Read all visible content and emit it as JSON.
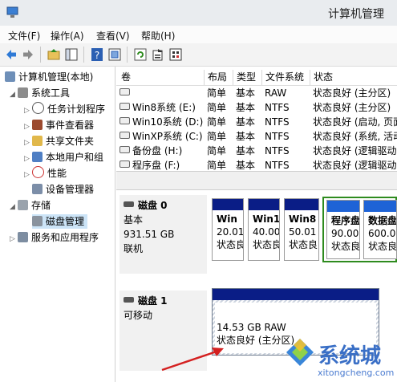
{
  "window": {
    "title": "计算机管理"
  },
  "menu": [
    "文件(F)",
    "操作(A)",
    "查看(V)",
    "帮助(H)"
  ],
  "toolbar": {
    "icons": [
      "back-icon",
      "forward-icon",
      "folder-up-icon",
      "show-hide-tree-icon",
      "help-icon",
      "properties-icon",
      "refresh-icon",
      "export-icon",
      "settings-icon"
    ]
  },
  "tree": {
    "root": "计算机管理(本地)",
    "system_tools": "系统工具",
    "task_scheduler": "任务计划程序",
    "event_viewer": "事件查看器",
    "shared_folders": "共享文件夹",
    "local_users": "本地用户和组",
    "performance": "性能",
    "device_manager": "设备管理器",
    "storage": "存储",
    "disk_management": "磁盘管理",
    "services_apps": "服务和应用程序"
  },
  "volume_list": {
    "headers": [
      "卷",
      "布局",
      "类型",
      "文件系统",
      "状态"
    ],
    "rows": [
      {
        "name": "",
        "layout": "简单",
        "type": "基本",
        "fs": "RAW",
        "status": "状态良好 (主分区)"
      },
      {
        "name": "Win8系统 (E:)",
        "layout": "简单",
        "type": "基本",
        "fs": "NTFS",
        "status": "状态良好 (主分区)"
      },
      {
        "name": "Win10系统 (D:)",
        "layout": "简单",
        "type": "基本",
        "fs": "NTFS",
        "status": "状态良好 (启动, 页面"
      },
      {
        "name": "WinXP系统 (C:)",
        "layout": "简单",
        "type": "基本",
        "fs": "NTFS",
        "status": "状态良好 (系统, 活动"
      },
      {
        "name": "备份盘 (H:)",
        "layout": "简单",
        "type": "基本",
        "fs": "NTFS",
        "status": "状态良好 (逻辑驱动"
      },
      {
        "name": "程序盘 (F:)",
        "layout": "简单",
        "type": "基本",
        "fs": "NTFS",
        "status": "状态良好 (逻辑驱动"
      }
    ]
  },
  "disk0": {
    "title": "磁盘 0",
    "kind": "基本",
    "size": "931.51 GB",
    "state": "联机",
    "partitions": [
      {
        "name": "Win",
        "size": "20.01",
        "status": "状态良"
      },
      {
        "name": "Win1",
        "size": "40.00",
        "status": "状态良"
      },
      {
        "name": "Win8",
        "size": "50.01",
        "status": "状态良"
      },
      {
        "name": "程序盘",
        "size": "90.00",
        "status": "状态良"
      },
      {
        "name": "数据盘",
        "size": "600.0",
        "status": "状态良"
      }
    ]
  },
  "disk1": {
    "title": "磁盘 1",
    "kind": "可移动",
    "partition": {
      "size": "14.53 GB RAW",
      "status": "状态良好 (主分区)"
    }
  },
  "watermark": {
    "text": "系统城",
    "url": "xitongcheng.com"
  },
  "colors": {
    "primary_bar": "#0a1d86",
    "logical_bar": "#1e63d6",
    "selection": "#2e8b1e",
    "annotation_arrow": "#d42020"
  }
}
